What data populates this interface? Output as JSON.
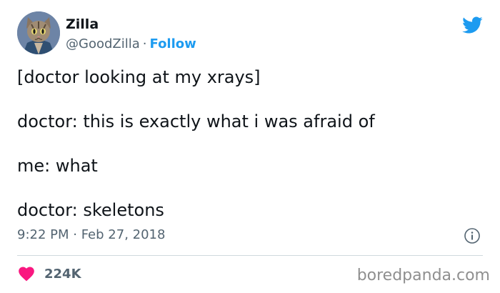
{
  "author": {
    "name": "Zilla",
    "handle": "@GoodZilla",
    "separator": "·",
    "follow_label": "Follow",
    "avatar_icon": "cat-avatar-icon"
  },
  "tweet": {
    "lines": [
      "[doctor looking at my xrays]",
      "doctor: this is exactly what i was afraid of",
      "me: what",
      "doctor: skeletons"
    ],
    "timestamp": "9:22 PM · Feb 27, 2018"
  },
  "engagement": {
    "like_count": "224K",
    "like_icon": "heart-icon",
    "like_color": "#f91880"
  },
  "brand": {
    "logo_icon": "twitter-bird-icon",
    "color": "#1d9bf0"
  },
  "watermark": "boredpanda.com"
}
